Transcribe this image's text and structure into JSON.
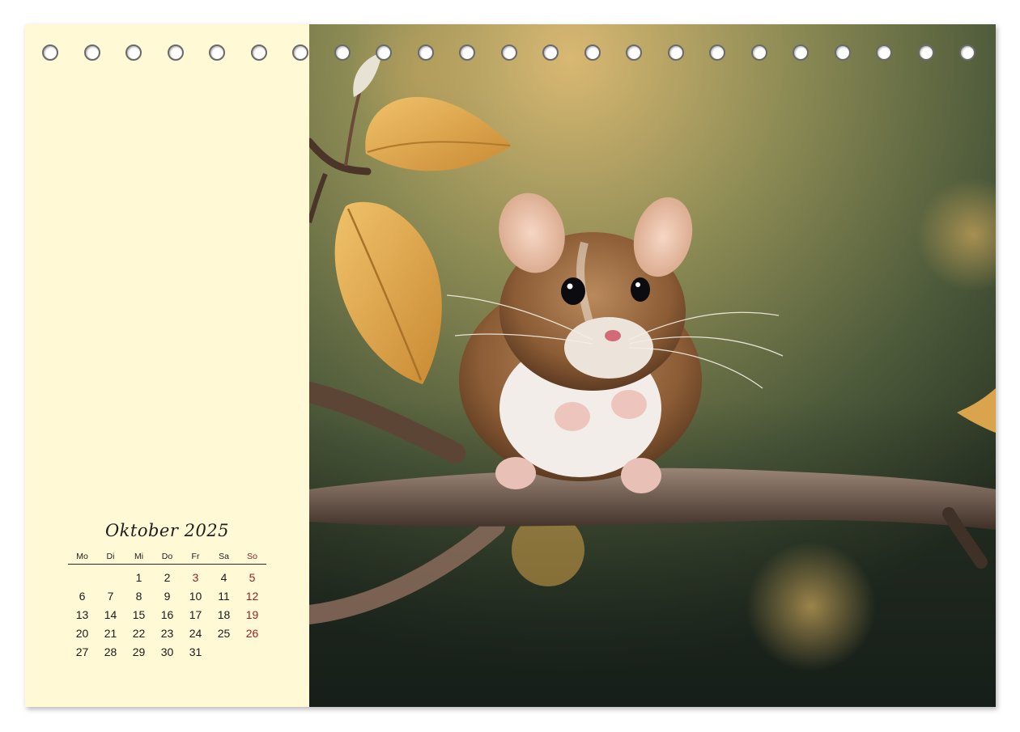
{
  "calendar": {
    "month_title": "Oktober 2025",
    "weekdays": [
      "Mo",
      "Di",
      "Mi",
      "Do",
      "Fr",
      "Sa",
      "So"
    ],
    "days": [
      "",
      "",
      "1",
      "2",
      "3",
      "4",
      "5",
      "6",
      "7",
      "8",
      "9",
      "10",
      "11",
      "12",
      "13",
      "14",
      "15",
      "16",
      "17",
      "18",
      "19",
      "20",
      "21",
      "22",
      "23",
      "24",
      "25",
      "26",
      "27",
      "28",
      "29",
      "30",
      "31",
      "",
      ""
    ],
    "highlighted_days": [
      "3",
      "5",
      "12",
      "19",
      "26"
    ],
    "highlight_color": "#9b1d1d"
  },
  "binding": {
    "hole_count": 23
  },
  "colors": {
    "panel_background": "#fff9d6",
    "photo_background": "#4c5438"
  },
  "photo": {
    "subject": "mouse-on-branch"
  }
}
